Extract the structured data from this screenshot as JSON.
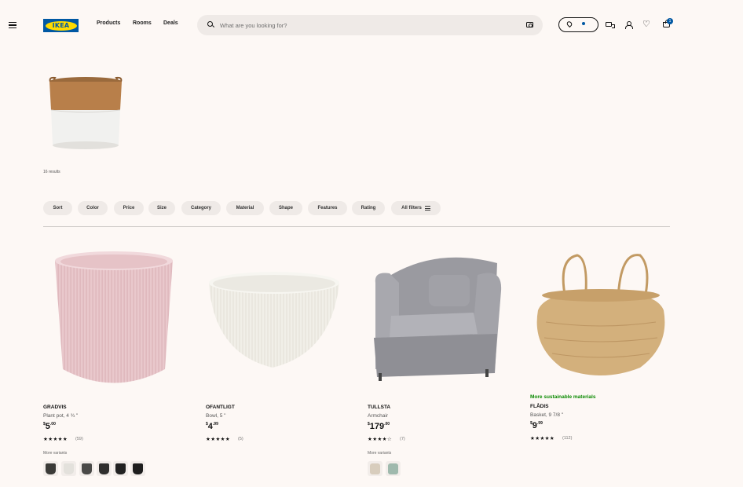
{
  "header": {
    "logo_text": "IKEA",
    "nav": [
      "Products",
      "Rooms",
      "Deals"
    ],
    "search_placeholder": "What are you looking for?",
    "cart_count": "1"
  },
  "hero": {
    "results_text": "16 results"
  },
  "filters": [
    "Sort",
    "Color",
    "Price",
    "Size",
    "Category",
    "Material",
    "Shape",
    "Features",
    "Rating",
    "All filters"
  ],
  "products": [
    {
      "name": "GRADVIS",
      "description": "Plant pot, 4 ¾ \"",
      "currency": "$",
      "price_main": "5",
      "price_decimal": ".00",
      "stars": "★★★★★",
      "reviews": "(59)",
      "more_variants": "More variants",
      "swatch_colors": [
        "#3b3b38",
        "#e3e1dc",
        "#4a4a48",
        "#2f2f2e",
        "#222222",
        "#1e1e1e"
      ]
    },
    {
      "name": "OFANTLIGT",
      "description": "Bowl, 5 \"",
      "currency": "$",
      "price_main": "4",
      "price_decimal": ".99",
      "stars": "★★★★★",
      "reviews": "(5)"
    },
    {
      "name": "TULLSTA",
      "description": "Armchair",
      "currency": "$",
      "price_main": "179",
      "price_decimal": ".00",
      "stars": "★★★★☆",
      "reviews": "(7)",
      "more_variants": "More variants",
      "swatch_colors": [
        "#d8cdbd",
        "#9fb9ad"
      ]
    },
    {
      "sustainable": "More sustainable materials",
      "name": "FLÅDIS",
      "description": "Basket, 9 7/8 \"",
      "currency": "$",
      "price_main": "9",
      "price_decimal": ".99",
      "stars": "★★★★★",
      "reviews": "(112)"
    }
  ]
}
